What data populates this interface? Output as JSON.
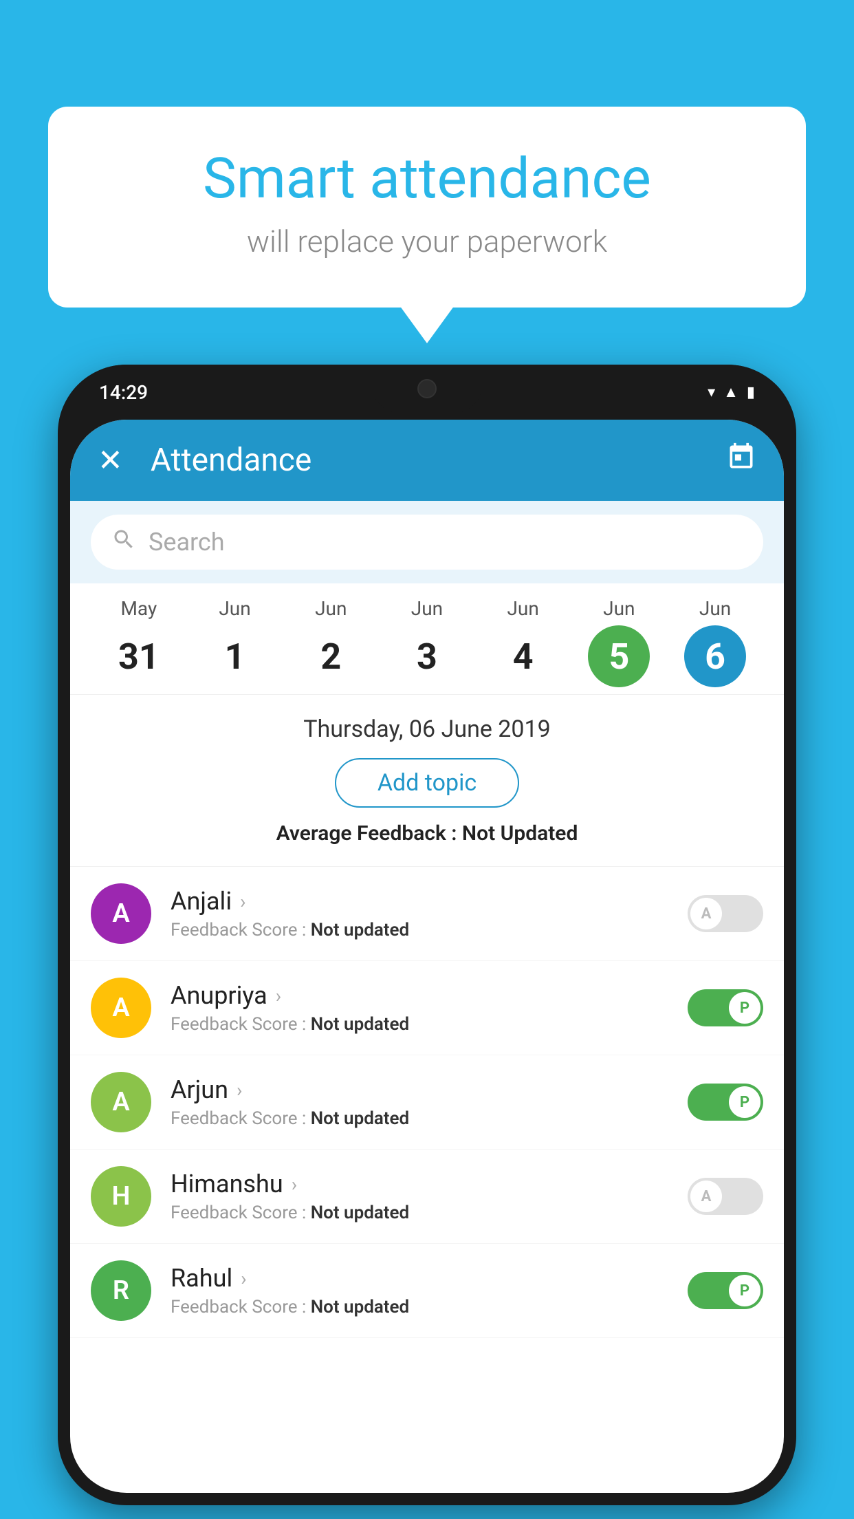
{
  "background": {
    "color": "#29b6e8"
  },
  "bubble": {
    "title": "Smart attendance",
    "subtitle": "will replace your paperwork"
  },
  "status_bar": {
    "time": "14:29",
    "icons": [
      "wifi",
      "signal",
      "battery"
    ]
  },
  "app_bar": {
    "title": "Attendance",
    "close_label": "✕",
    "calendar_label": "📅"
  },
  "search": {
    "placeholder": "Search"
  },
  "calendar": {
    "days": [
      {
        "month": "May",
        "date": "31",
        "type": "normal"
      },
      {
        "month": "Jun",
        "date": "1",
        "type": "normal"
      },
      {
        "month": "Jun",
        "date": "2",
        "type": "normal"
      },
      {
        "month": "Jun",
        "date": "3",
        "type": "normal"
      },
      {
        "month": "Jun",
        "date": "4",
        "type": "normal"
      },
      {
        "month": "Jun",
        "date": "5",
        "type": "today"
      },
      {
        "month": "Jun",
        "date": "6",
        "type": "selected"
      }
    ]
  },
  "date_info": {
    "label": "Thursday, 06 June 2019",
    "add_topic_label": "Add topic",
    "avg_feedback_prefix": "Average Feedback : ",
    "avg_feedback_value": "Not Updated"
  },
  "students": [
    {
      "name": "Anjali",
      "avatar_letter": "A",
      "avatar_color": "#9c27b0",
      "feedback_prefix": "Feedback Score : ",
      "feedback_value": "Not updated",
      "toggle": "off",
      "toggle_letter": "A"
    },
    {
      "name": "Anupriya",
      "avatar_letter": "A",
      "avatar_color": "#ffc107",
      "feedback_prefix": "Feedback Score : ",
      "feedback_value": "Not updated",
      "toggle": "on",
      "toggle_letter": "P"
    },
    {
      "name": "Arjun",
      "avatar_letter": "A",
      "avatar_color": "#8bc34a",
      "feedback_prefix": "Feedback Score : ",
      "feedback_value": "Not updated",
      "toggle": "on",
      "toggle_letter": "P"
    },
    {
      "name": "Himanshu",
      "avatar_letter": "H",
      "avatar_color": "#8bc34a",
      "feedback_prefix": "Feedback Score : ",
      "feedback_value": "Not updated",
      "toggle": "off",
      "toggle_letter": "A"
    },
    {
      "name": "Rahul",
      "avatar_letter": "R",
      "avatar_color": "#4caf50",
      "feedback_prefix": "Feedback Score : ",
      "feedback_value": "Not updated",
      "toggle": "on",
      "toggle_letter": "P"
    }
  ]
}
